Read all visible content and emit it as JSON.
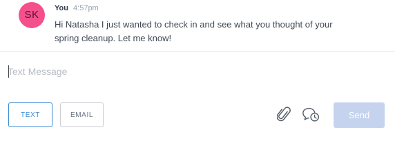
{
  "message": {
    "avatar_initials": "SK",
    "avatar_color": "#f4508c",
    "sender": "You",
    "time": "4:57pm",
    "body": "Hi Natasha I just wanted to check in and see what you thought of your spring cleanup. Let me know!"
  },
  "composer": {
    "placeholder": "Text Message",
    "value": "",
    "channels": {
      "text_label": "TEXT",
      "email_label": "EMAIL",
      "selected": "TEXT"
    },
    "icons": {
      "attach": "paperclip-icon",
      "schedule": "schedule-message-icon"
    },
    "send_label": "Send",
    "accent_color": "#3a8ad4",
    "send_disabled_color": "#c5d3ee"
  }
}
